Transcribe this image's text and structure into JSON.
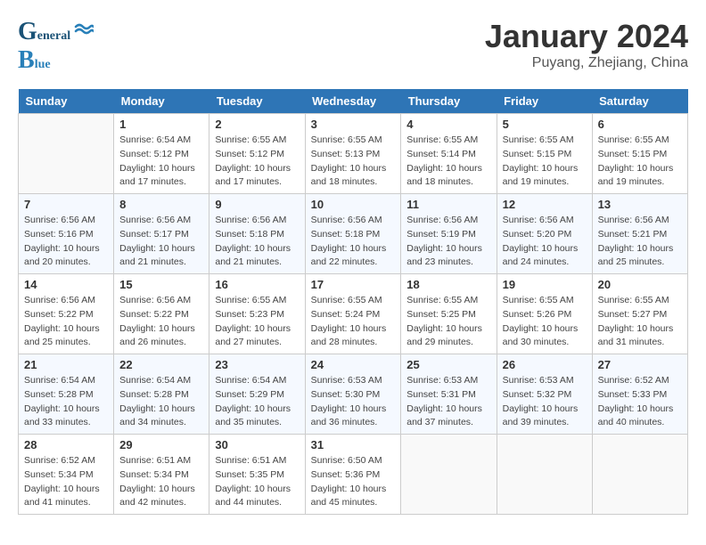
{
  "header": {
    "logo_general": "General",
    "logo_blue": "Blue",
    "month_title": "January 2024",
    "location": "Puyang, Zhejiang, China"
  },
  "weekdays": [
    "Sunday",
    "Monday",
    "Tuesday",
    "Wednesday",
    "Thursday",
    "Friday",
    "Saturday"
  ],
  "weeks": [
    [
      {
        "day": "",
        "sunrise": "",
        "sunset": "",
        "daylight": ""
      },
      {
        "day": "1",
        "sunrise": "Sunrise: 6:54 AM",
        "sunset": "Sunset: 5:12 PM",
        "daylight": "Daylight: 10 hours and 17 minutes."
      },
      {
        "day": "2",
        "sunrise": "Sunrise: 6:55 AM",
        "sunset": "Sunset: 5:12 PM",
        "daylight": "Daylight: 10 hours and 17 minutes."
      },
      {
        "day": "3",
        "sunrise": "Sunrise: 6:55 AM",
        "sunset": "Sunset: 5:13 PM",
        "daylight": "Daylight: 10 hours and 18 minutes."
      },
      {
        "day": "4",
        "sunrise": "Sunrise: 6:55 AM",
        "sunset": "Sunset: 5:14 PM",
        "daylight": "Daylight: 10 hours and 18 minutes."
      },
      {
        "day": "5",
        "sunrise": "Sunrise: 6:55 AM",
        "sunset": "Sunset: 5:15 PM",
        "daylight": "Daylight: 10 hours and 19 minutes."
      },
      {
        "day": "6",
        "sunrise": "Sunrise: 6:55 AM",
        "sunset": "Sunset: 5:15 PM",
        "daylight": "Daylight: 10 hours and 19 minutes."
      }
    ],
    [
      {
        "day": "7",
        "sunrise": "Sunrise: 6:56 AM",
        "sunset": "Sunset: 5:16 PM",
        "daylight": "Daylight: 10 hours and 20 minutes."
      },
      {
        "day": "8",
        "sunrise": "Sunrise: 6:56 AM",
        "sunset": "Sunset: 5:17 PM",
        "daylight": "Daylight: 10 hours and 21 minutes."
      },
      {
        "day": "9",
        "sunrise": "Sunrise: 6:56 AM",
        "sunset": "Sunset: 5:18 PM",
        "daylight": "Daylight: 10 hours and 21 minutes."
      },
      {
        "day": "10",
        "sunrise": "Sunrise: 6:56 AM",
        "sunset": "Sunset: 5:18 PM",
        "daylight": "Daylight: 10 hours and 22 minutes."
      },
      {
        "day": "11",
        "sunrise": "Sunrise: 6:56 AM",
        "sunset": "Sunset: 5:19 PM",
        "daylight": "Daylight: 10 hours and 23 minutes."
      },
      {
        "day": "12",
        "sunrise": "Sunrise: 6:56 AM",
        "sunset": "Sunset: 5:20 PM",
        "daylight": "Daylight: 10 hours and 24 minutes."
      },
      {
        "day": "13",
        "sunrise": "Sunrise: 6:56 AM",
        "sunset": "Sunset: 5:21 PM",
        "daylight": "Daylight: 10 hours and 25 minutes."
      }
    ],
    [
      {
        "day": "14",
        "sunrise": "Sunrise: 6:56 AM",
        "sunset": "Sunset: 5:22 PM",
        "daylight": "Daylight: 10 hours and 25 minutes."
      },
      {
        "day": "15",
        "sunrise": "Sunrise: 6:56 AM",
        "sunset": "Sunset: 5:22 PM",
        "daylight": "Daylight: 10 hours and 26 minutes."
      },
      {
        "day": "16",
        "sunrise": "Sunrise: 6:55 AM",
        "sunset": "Sunset: 5:23 PM",
        "daylight": "Daylight: 10 hours and 27 minutes."
      },
      {
        "day": "17",
        "sunrise": "Sunrise: 6:55 AM",
        "sunset": "Sunset: 5:24 PM",
        "daylight": "Daylight: 10 hours and 28 minutes."
      },
      {
        "day": "18",
        "sunrise": "Sunrise: 6:55 AM",
        "sunset": "Sunset: 5:25 PM",
        "daylight": "Daylight: 10 hours and 29 minutes."
      },
      {
        "day": "19",
        "sunrise": "Sunrise: 6:55 AM",
        "sunset": "Sunset: 5:26 PM",
        "daylight": "Daylight: 10 hours and 30 minutes."
      },
      {
        "day": "20",
        "sunrise": "Sunrise: 6:55 AM",
        "sunset": "Sunset: 5:27 PM",
        "daylight": "Daylight: 10 hours and 31 minutes."
      }
    ],
    [
      {
        "day": "21",
        "sunrise": "Sunrise: 6:54 AM",
        "sunset": "Sunset: 5:28 PM",
        "daylight": "Daylight: 10 hours and 33 minutes."
      },
      {
        "day": "22",
        "sunrise": "Sunrise: 6:54 AM",
        "sunset": "Sunset: 5:28 PM",
        "daylight": "Daylight: 10 hours and 34 minutes."
      },
      {
        "day": "23",
        "sunrise": "Sunrise: 6:54 AM",
        "sunset": "Sunset: 5:29 PM",
        "daylight": "Daylight: 10 hours and 35 minutes."
      },
      {
        "day": "24",
        "sunrise": "Sunrise: 6:53 AM",
        "sunset": "Sunset: 5:30 PM",
        "daylight": "Daylight: 10 hours and 36 minutes."
      },
      {
        "day": "25",
        "sunrise": "Sunrise: 6:53 AM",
        "sunset": "Sunset: 5:31 PM",
        "daylight": "Daylight: 10 hours and 37 minutes."
      },
      {
        "day": "26",
        "sunrise": "Sunrise: 6:53 AM",
        "sunset": "Sunset: 5:32 PM",
        "daylight": "Daylight: 10 hours and 39 minutes."
      },
      {
        "day": "27",
        "sunrise": "Sunrise: 6:52 AM",
        "sunset": "Sunset: 5:33 PM",
        "daylight": "Daylight: 10 hours and 40 minutes."
      }
    ],
    [
      {
        "day": "28",
        "sunrise": "Sunrise: 6:52 AM",
        "sunset": "Sunset: 5:34 PM",
        "daylight": "Daylight: 10 hours and 41 minutes."
      },
      {
        "day": "29",
        "sunrise": "Sunrise: 6:51 AM",
        "sunset": "Sunset: 5:34 PM",
        "daylight": "Daylight: 10 hours and 42 minutes."
      },
      {
        "day": "30",
        "sunrise": "Sunrise: 6:51 AM",
        "sunset": "Sunset: 5:35 PM",
        "daylight": "Daylight: 10 hours and 44 minutes."
      },
      {
        "day": "31",
        "sunrise": "Sunrise: 6:50 AM",
        "sunset": "Sunset: 5:36 PM",
        "daylight": "Daylight: 10 hours and 45 minutes."
      },
      {
        "day": "",
        "sunrise": "",
        "sunset": "",
        "daylight": ""
      },
      {
        "day": "",
        "sunrise": "",
        "sunset": "",
        "daylight": ""
      },
      {
        "day": "",
        "sunrise": "",
        "sunset": "",
        "daylight": ""
      }
    ]
  ]
}
